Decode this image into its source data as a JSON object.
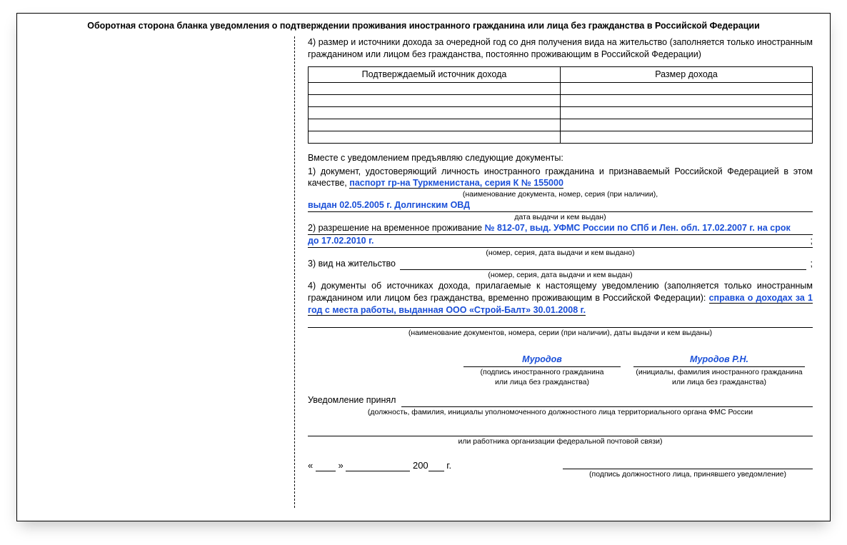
{
  "header": "Оборотная сторона бланка уведомления о подтверждении проживания иностранного гражданина или лица без гражданства в Российской Федерации",
  "item4_text": "4) размер и источники дохода за очередной год со дня получения вида на жительство (заполняется только иностранным гражданином или лицом без гражданства, постоянно проживающим в Российской Федерации)",
  "table": {
    "col1": "Подтверждаемый источник дохода",
    "col2": "Размер дохода"
  },
  "together_text": "Вместе с уведомлением предъявляю следующие документы:",
  "doc1_prefix": "1) документ, удостоверяющий личность иностранного гражданина и признаваемый Российской Федерацией в этом качестве, ",
  "doc1_value": "паспорт гр-на Туркменистана, серия К № 155000",
  "doc1_hint": "(наименование документа, номер, серия (при наличии),",
  "doc1_issued": "выдан  02.05.2005 г. Долгинским ОВД",
  "doc1_hint2": "дата выдачи и кем выдан)",
  "doc2_prefix": "2) разрешение на временное проживание ",
  "doc2_value": "№ 812-07, выд. УФМС России по СПб и Лен. обл. 17.02.2007 г. на срок до 17.02.2010 г.",
  "doc2_hint": "(номер, серия, дата выдачи и кем выдано)",
  "doc3_prefix": "3) вид на жительство",
  "doc3_hint": "(номер, серия, дата выдачи и кем выдан)",
  "doc4_text": "4) документы об источниках дохода, прилагаемые к настоящему уведомлению (заполняется только иностранным гражданином или лицом без гражданства, временно проживающим в Российской Федерации): ",
  "doc4_value": "справка о доходах за 1 год с места работы, выданная ООО «Строй-Балт» 30.01.2008 г.",
  "doc4_hint": "(наименование документов, номера, серии (при наличии), даты выдачи и кем выданы)",
  "sig1_value": "Муродов",
  "sig1_hint": "(подпись иностранного гражданина\nили лица без гражданства)",
  "sig2_value": "Муродов Р.Н.",
  "sig2_hint": "(инициалы, фамилия иностранного гражданина\nили лица без гражданства)",
  "accepted_label": "Уведомление принял",
  "accepted_hint": "(должность, фамилия, инициалы уполномоченного должностного лица территориального органа ФМС России",
  "accepted_hint2": "или работника организации федеральной почтовой связи)",
  "date_year_prefix": "200",
  "date_year_suffix": "г.",
  "final_sig_hint": "(подпись должностного лица, принявшего уведомление)",
  "quote_open": "«",
  "quote_close": "»"
}
